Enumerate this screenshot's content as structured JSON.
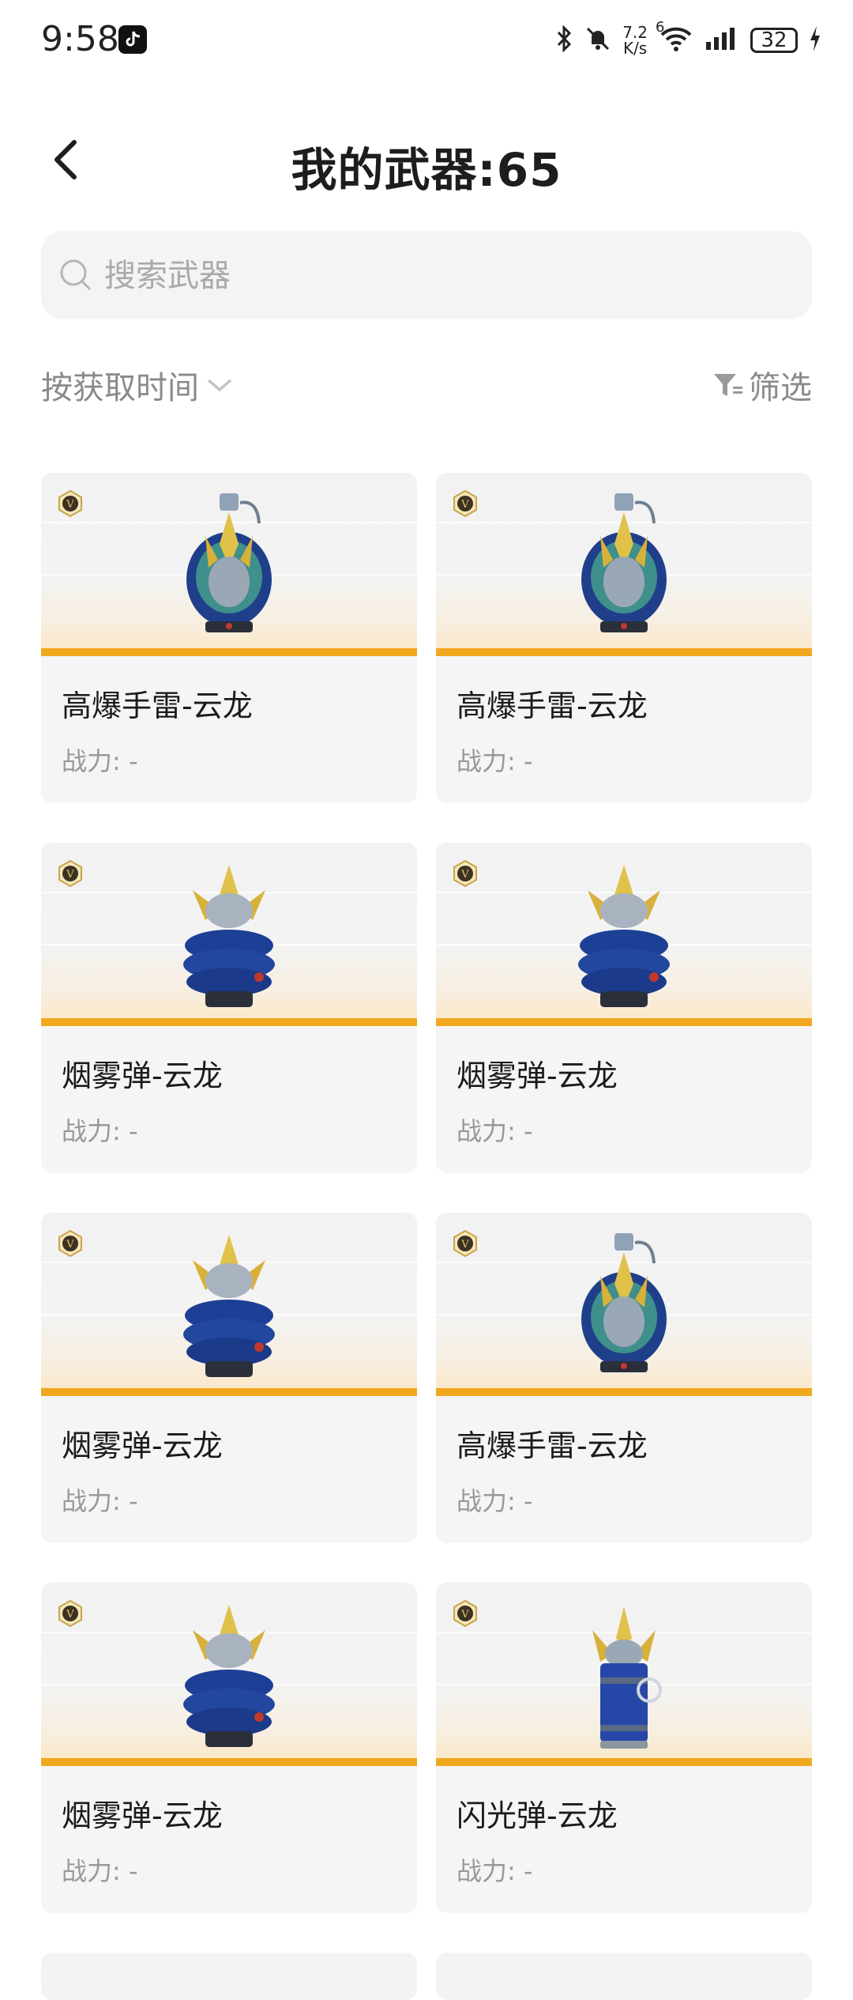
{
  "status_bar": {
    "time": "9:58",
    "net_speed_value": "7.2",
    "net_speed_unit": "K/s",
    "wifi_tag": "6",
    "battery": "32"
  },
  "header": {
    "title": "我的武器:65"
  },
  "search": {
    "placeholder": "搜索武器"
  },
  "sort": {
    "label": "按获取时间"
  },
  "filter": {
    "label": "筛选"
  },
  "colors": {
    "accent": "#f0a81e",
    "badge_gold": "#c9a44c",
    "text_muted": "#999999"
  },
  "weapons": [
    {
      "name": "高爆手雷-云龙",
      "power": "战力: -",
      "icon": "grenade-icon"
    },
    {
      "name": "高爆手雷-云龙",
      "power": "战力: -",
      "icon": "grenade-icon"
    },
    {
      "name": "烟雾弹-云龙",
      "power": "战力: -",
      "icon": "smoke-grenade-icon"
    },
    {
      "name": "烟雾弹-云龙",
      "power": "战力: -",
      "icon": "smoke-grenade-icon"
    },
    {
      "name": "烟雾弹-云龙",
      "power": "战力: -",
      "icon": "smoke-grenade-icon"
    },
    {
      "name": "高爆手雷-云龙",
      "power": "战力: -",
      "icon": "grenade-icon"
    },
    {
      "name": "烟雾弹-云龙",
      "power": "战力: -",
      "icon": "smoke-grenade-icon"
    },
    {
      "name": "闪光弹-云龙",
      "power": "战力: -",
      "icon": "flashbang-icon"
    }
  ]
}
